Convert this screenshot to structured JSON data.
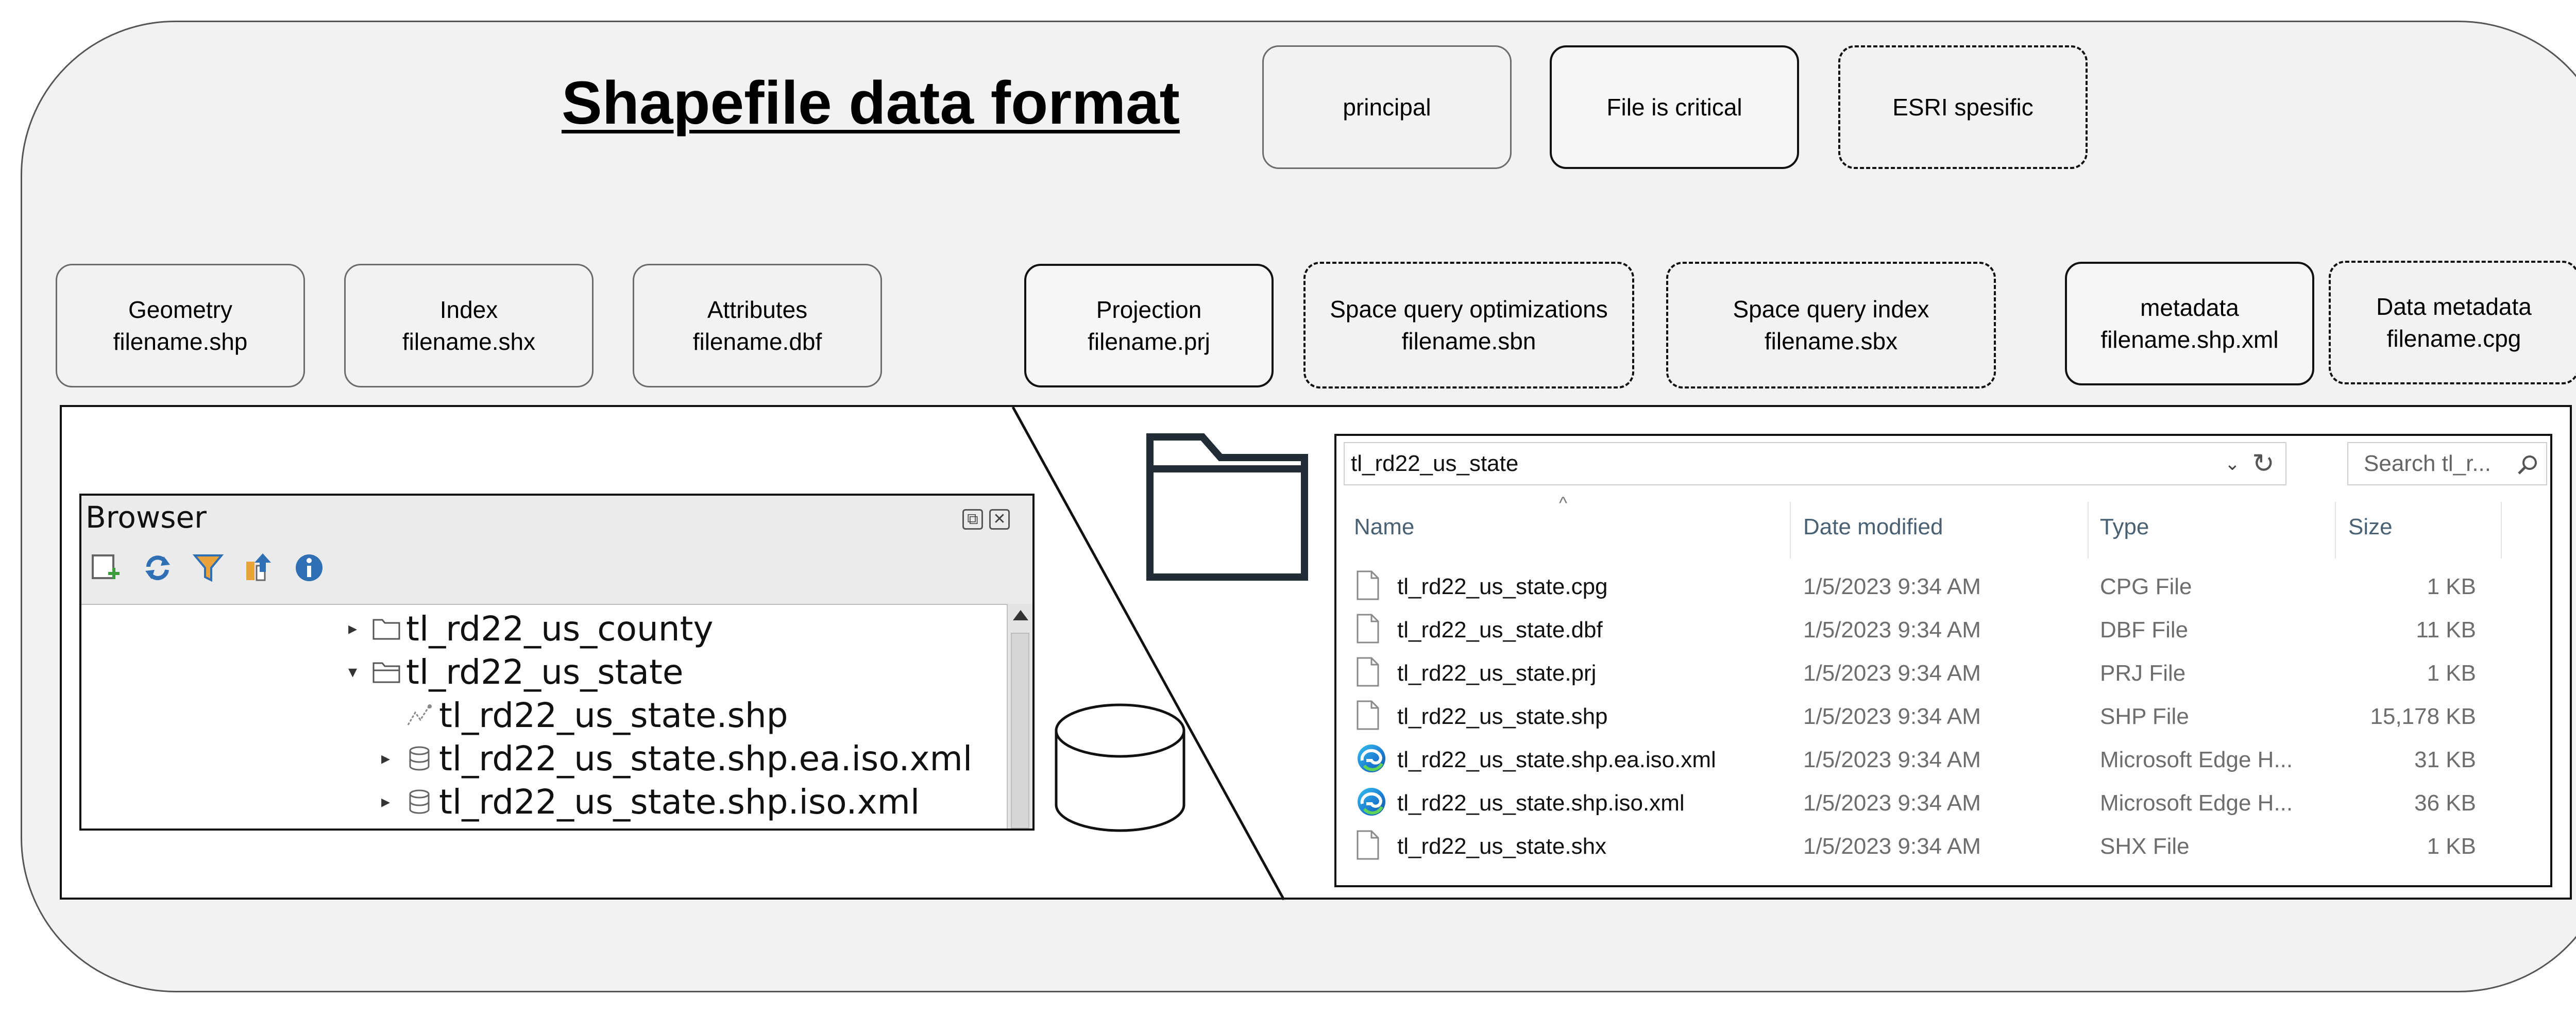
{
  "diagram": {
    "title": "Shapefile data format",
    "legend": [
      {
        "label": "principal",
        "style": "principal"
      },
      {
        "label": "File is critical",
        "style": "critical"
      },
      {
        "label": "ESRI spesific",
        "style": "esri"
      }
    ],
    "files": [
      {
        "name": "Geometry",
        "file": "filename.shp",
        "style": "principal"
      },
      {
        "name": "Index",
        "file": "filename.shx",
        "style": "principal"
      },
      {
        "name": "Attributes",
        "file": "filename.dbf",
        "style": "principal"
      },
      {
        "name": "Projection",
        "file": "filename.prj",
        "style": "critical"
      },
      {
        "name": "Space query optimizations",
        "file": "filename.sbn",
        "style": "esri"
      },
      {
        "name": "Space query index",
        "file": "filename.sbx",
        "style": "esri"
      },
      {
        "name": "metadata",
        "file": "filename.shp.xml",
        "style": "critical"
      },
      {
        "name": "Data metadata",
        "file": "filename.cpg",
        "style": "esri"
      }
    ]
  },
  "qgis_browser": {
    "title": "Browser",
    "toolbar_icons": [
      "add-layer-icon",
      "refresh-icon",
      "filter-icon",
      "collapse-all-icon",
      "properties-icon"
    ],
    "tree": [
      {
        "label": "tl_rd22_us_county",
        "icon": "folder-icon",
        "expander": "▸"
      },
      {
        "label": "tl_rd22_us_state",
        "icon": "open-folder-icon",
        "expander": "▾"
      },
      {
        "label": "tl_rd22_us_state.shp",
        "icon": "vector-layer-icon",
        "expander": ""
      },
      {
        "label": "tl_rd22_us_state.shp.ea.iso.xml",
        "icon": "database-icon",
        "expander": "▸"
      },
      {
        "label": "tl_rd22_us_state.shp.iso.xml",
        "icon": "database-icon",
        "expander": "▸"
      }
    ]
  },
  "explorer": {
    "address": "tl_rd22_us_state",
    "search_placeholder": "Search tl_r...",
    "columns": {
      "name": "Name",
      "date": "Date modified",
      "type": "Type",
      "size": "Size"
    },
    "files": [
      {
        "name": "tl_rd22_us_state.cpg",
        "date": "1/5/2023 9:34 AM",
        "type": "CPG File",
        "size": "1 KB",
        "icon": "file-icon"
      },
      {
        "name": "tl_rd22_us_state.dbf",
        "date": "1/5/2023 9:34 AM",
        "type": "DBF File",
        "size": "11 KB",
        "icon": "file-icon"
      },
      {
        "name": "tl_rd22_us_state.prj",
        "date": "1/5/2023 9:34 AM",
        "type": "PRJ File",
        "size": "1 KB",
        "icon": "file-icon"
      },
      {
        "name": "tl_rd22_us_state.shp",
        "date": "1/5/2023 9:34 AM",
        "type": "SHP File",
        "size": "15,178 KB",
        "icon": "file-icon"
      },
      {
        "name": "tl_rd22_us_state.shp.ea.iso.xml",
        "date": "1/5/2023 9:34 AM",
        "type": "Microsoft Edge H...",
        "size": "31 KB",
        "icon": "edge-icon"
      },
      {
        "name": "tl_rd22_us_state.shp.iso.xml",
        "date": "1/5/2023 9:34 AM",
        "type": "Microsoft Edge H...",
        "size": "36 KB",
        "icon": "edge-icon"
      },
      {
        "name": "tl_rd22_us_state.shx",
        "date": "1/5/2023 9:34 AM",
        "type": "SHX File",
        "size": "1 KB",
        "icon": "file-icon"
      }
    ]
  },
  "colors": {
    "frame": "#f2f2f2",
    "header_text": "#4a6173",
    "muted_text": "#6d6d6d",
    "qgis_blue": "#2f6fb3",
    "qgis_amber": "#e8a33b"
  }
}
